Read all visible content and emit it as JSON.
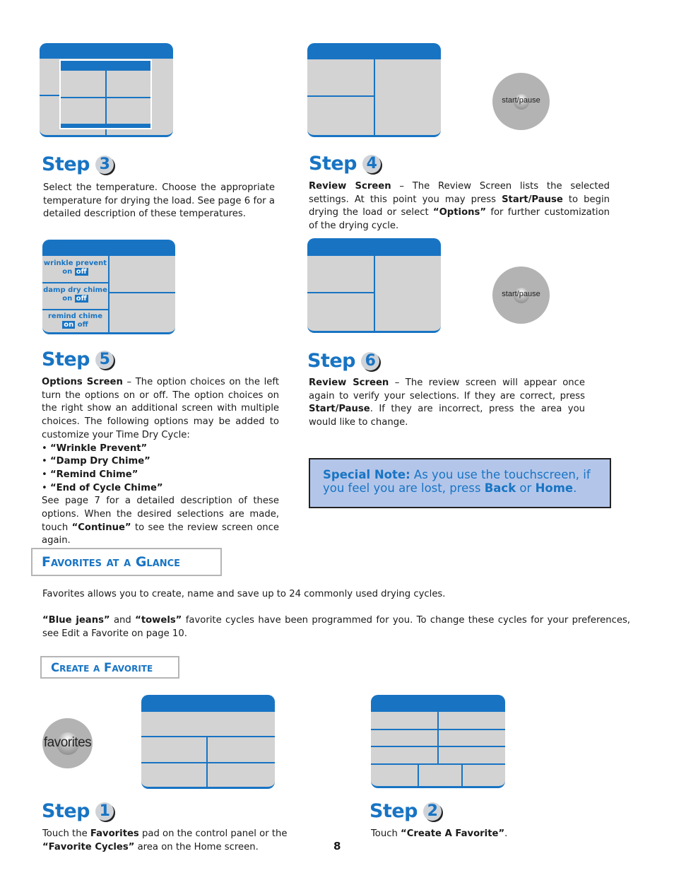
{
  "page_number": "8",
  "colors": {
    "accent": "#1874c3",
    "screen_gray": "#d3d3d3",
    "note_bg": "#b3c6ea",
    "pad_gray": "#b3b3b3"
  },
  "step3": {
    "label": "Step",
    "number": "3",
    "text": "Select the temperature.  Choose the appropriate temperature for drying the load.  See page 6 for a detailed description of these temperatures."
  },
  "step4": {
    "label": "Step",
    "number": "4",
    "pad_label": "start/pause",
    "title": "Review Screen",
    "text_1": " – The Review Screen lists the selected settings. At this point you may press ",
    "bold_1": "Start/Pause",
    "text_2": " to begin drying the load or select ",
    "bold_2": "“Options”",
    "text_3": " for further customization of the drying cycle."
  },
  "step5": {
    "label": "Step",
    "number": "5",
    "screen_options": [
      {
        "name": "wrinkle prevent",
        "on": "on",
        "off": "off",
        "selected": "off"
      },
      {
        "name": "damp dry chime",
        "on": "on",
        "off": "off",
        "selected": "off"
      },
      {
        "name": "remind chime",
        "on": "on",
        "off": "off",
        "selected": "on"
      }
    ],
    "title": "Options Screen",
    "intro": " – The option choices on the left turn the options on or off. The option choices on the right show an additional screen with multiple choices. The following options may be added to customize your Time Dry Cycle:",
    "bullets": [
      "“Wrinkle Prevent”",
      "“Damp Dry Chime”",
      "“Remind Chime”",
      "“End of Cycle Chime”"
    ],
    "outro_1": "See page 7 for a detailed description of these options. When the desired selections are made, touch ",
    "outro_bold": "“Continue”",
    "outro_2": " to see the review screen once again."
  },
  "step6": {
    "label": "Step",
    "number": "6",
    "pad_label": "start/pause",
    "title": "Review Screen",
    "text_1": " – The review screen will appear once again to verify your selections.  If they are correct, press ",
    "bold_1": "Start/Pause",
    "text_2": ".  If they are incorrect, press the area you would like to change."
  },
  "special_note": {
    "title": "Special Note:",
    "text_1": "  As you use the touchscreen, if you feel you are lost, press ",
    "bold_1": "Back",
    "text_2": " or ",
    "bold_2": "Home",
    "text_3": "."
  },
  "favorites_section": {
    "heading": "Favorites at a Glance",
    "para1": "Favorites allows you to create, name and save up to 24 commonly used drying cycles.",
    "para2_bold1": "“Blue jeans”",
    "para2_text1": " and ",
    "para2_bold2": "“towels”",
    "para2_text2": " favorite cycles have been programmed for you.  To change these cycles for your preferences, see Edit a Favorite on page 10."
  },
  "create_section": {
    "heading": "Create a Favorite"
  },
  "step1": {
    "label": "Step",
    "number": "1",
    "pad_label": "favorites",
    "text_1": "Touch the ",
    "bold_1": "Favorites",
    "text_2": " pad on the control panel or the ",
    "bold_2": "“Favorite Cycles”",
    "text_3": " area on the Home screen."
  },
  "step2": {
    "label": "Step",
    "number": "2",
    "text_1": "Touch ",
    "bold_1": "“Create A Favorite”",
    "text_2": "."
  }
}
